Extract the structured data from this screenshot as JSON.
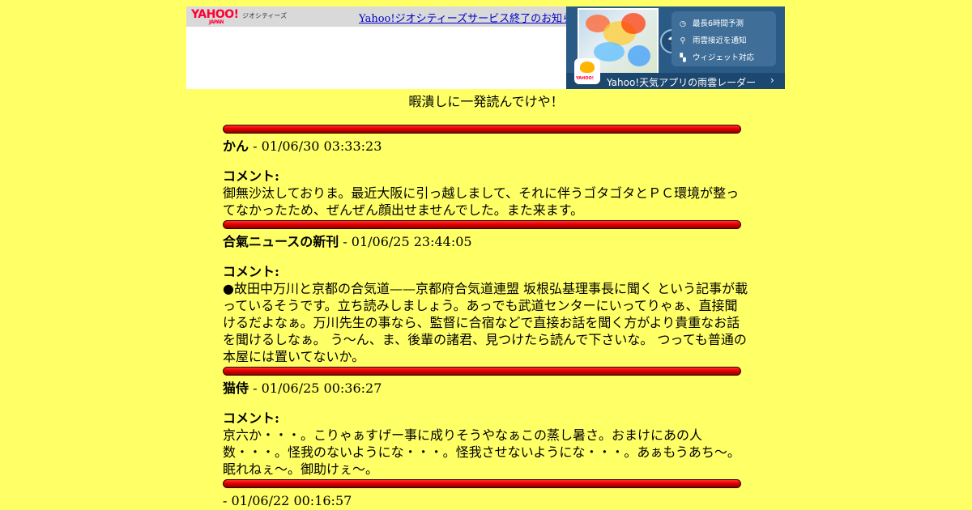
{
  "ad": {
    "logo_text": "YAHOO!",
    "logo_sub": "JAPAN",
    "geo_label": "ジオシティーズ",
    "notice_link": "Yahoo!ジオシティーズサービス終了のお知らせ",
    "features": [
      {
        "icon": "clock-icon",
        "glyph": "◷",
        "label": "最長6時間予測"
      },
      {
        "icon": "pin-icon",
        "glyph": "⚲",
        "label": "雨雲接近を通知"
      },
      {
        "icon": "widget-icon",
        "glyph": "▚",
        "label": "ウィジェット対応"
      }
    ],
    "app_icon_label": "YAHOO!",
    "app_text": "Yahoo!天気アプリの雨雲レーダー",
    "app_chevron": "›"
  },
  "tagline": "暇潰しに一発読んでけや！",
  "comment_label": "コメント:",
  "posts": [
    {
      "name": "かん",
      "date": " - 01/06/30 03:33:23",
      "body": "御無沙汰しておりま。最近大阪に引っ越しまして、それに伴うゴタゴタとＰＣ環境が整ってなかったため、ぜんぜん顔出せませんでした。また来ます。"
    },
    {
      "name": "合氣ニュースの新刊",
      "date": " - 01/06/25 23:44:05",
      "body": "●故田中万川と京都の合気道——京都府合気道連盟 坂根弘基理事長に聞く という記事が載っているそうです。立ち読みしましょう。あっでも武道センターにいってりゃぁ、直接聞けるだよなぁ。万川先生の事なら、監督に合宿などで直接お話を聞く方がより貴重なお話を聞けるしなぁ。 う～ん、ま、後輩の諸君、見つけたら読んで下さいな。 つっても普通の本屋には置いてないか。"
    },
    {
      "name": "猫侍",
      "date": " - 01/06/25 00:36:27",
      "body": "京六か・・・。こりゃぁすげー事に成りそうやなぁこの蒸し暑さ。おまけにあの人数・・・。怪我のないようにな・・・。怪我させないようにな・・・。あぁもうあち～。眠れねぇ～。御助けぇ～。"
    },
    {
      "name": "",
      "date": "- 01/06/22 00:16:57",
      "body": ""
    }
  ],
  "colors": {
    "page_background": "#ffff66",
    "rule_red": "#ee0000",
    "link_blue": "#0000cc"
  }
}
